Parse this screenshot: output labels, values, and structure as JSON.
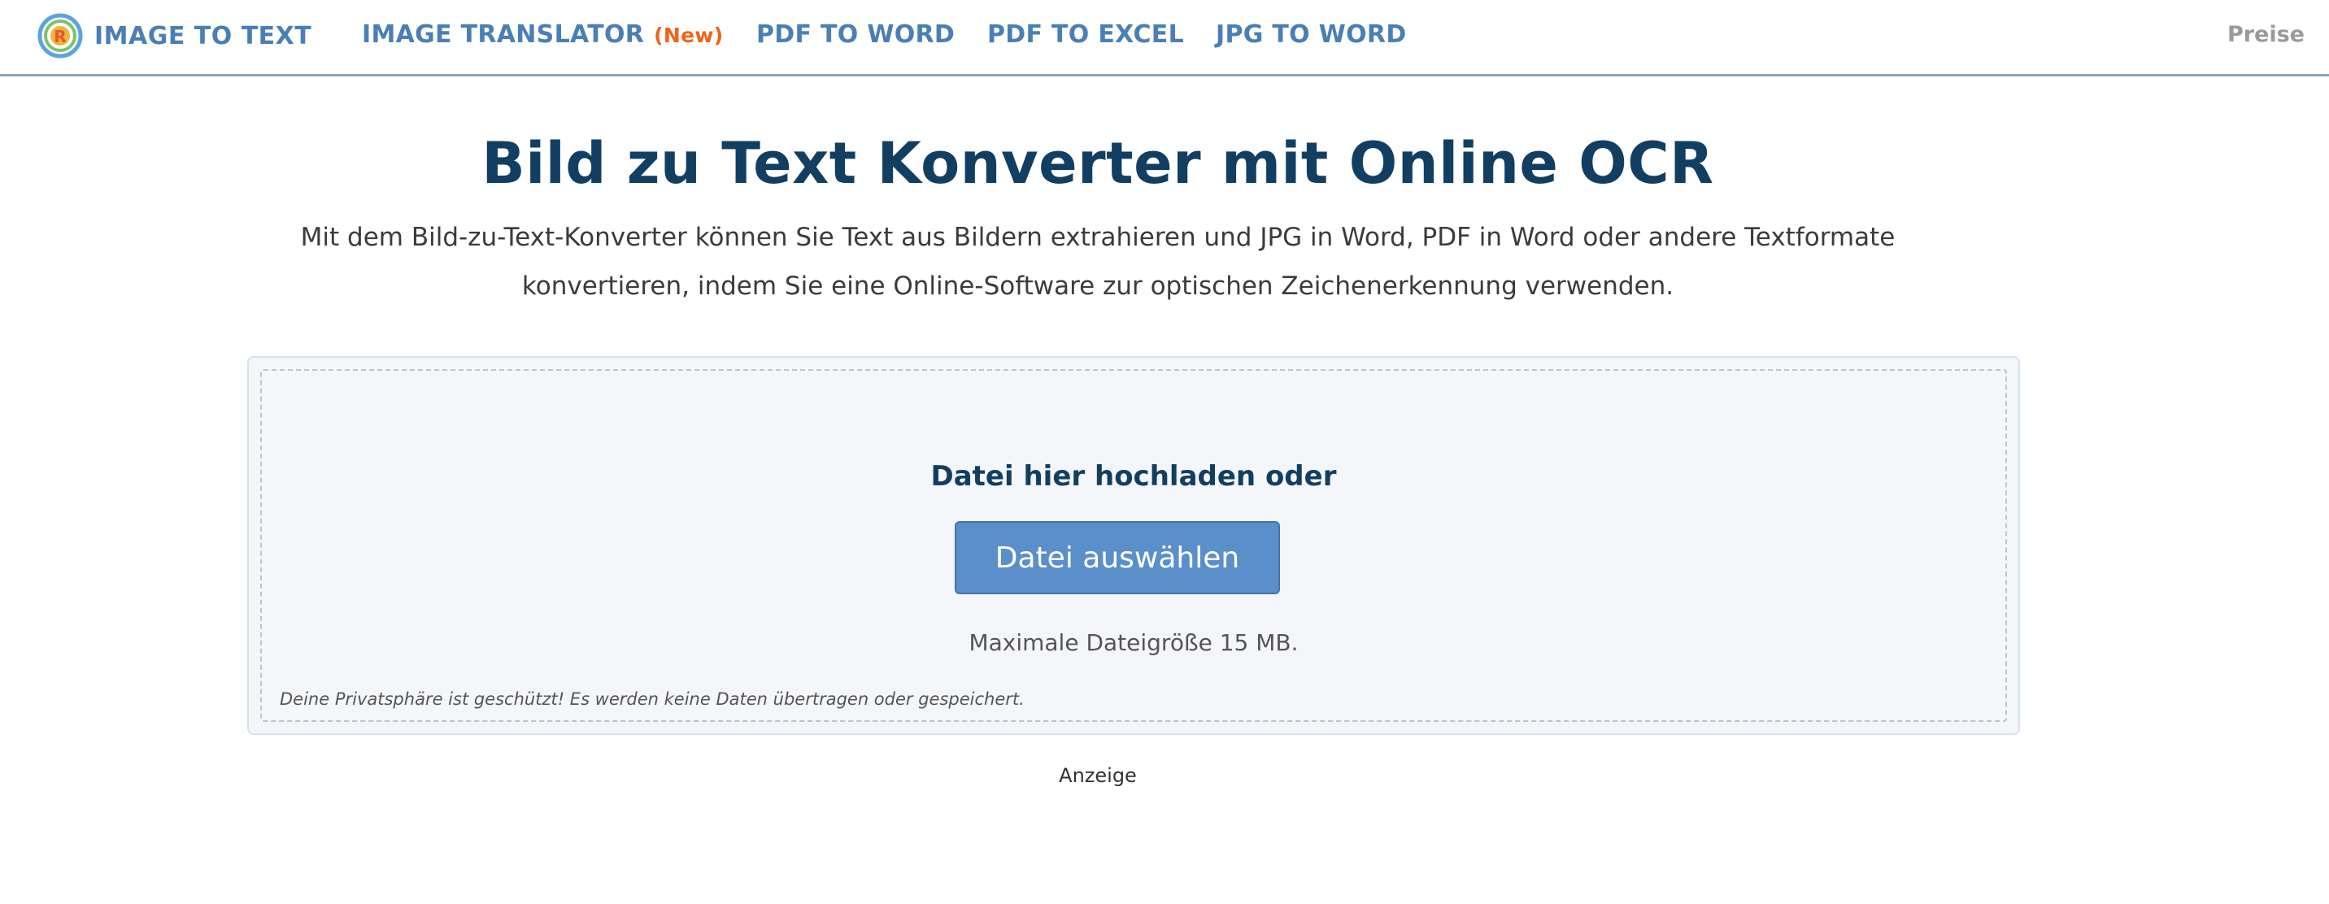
{
  "header": {
    "brand": "IMAGE TO TEXT",
    "nav": [
      {
        "label": "IMAGE TRANSLATOR",
        "badge": "(New)"
      },
      {
        "label": "PDF TO WORD"
      },
      {
        "label": "PDF TO EXCEL"
      },
      {
        "label": "JPG TO WORD"
      }
    ],
    "pricing_label": "Preise"
  },
  "main": {
    "title": "Bild zu Text Konverter mit Online OCR",
    "description": "Mit dem Bild-zu-Text-Konverter können Sie Text aus Bildern extrahieren und JPG in Word, PDF in Word oder andere Textformate konvertieren, indem Sie eine Online-Software zur optischen Zeichenerkennung verwenden."
  },
  "upload": {
    "heading": "Datei hier hochladen oder",
    "button_label": "Datei auswählen",
    "max_size": "Maximale Dateigröße 15 MB.",
    "privacy": "Deine Privatsphäre ist geschützt! Es werden keine Daten übertragen oder gespeichert."
  },
  "ad_label": "Anzeige",
  "colors": {
    "brand_blue": "#4a7fb5",
    "title_navy": "#123f61",
    "new_badge_orange": "#f06418",
    "button_blue": "#5b8fc9"
  },
  "icons": {
    "logo": "circular-r-logo-icon"
  }
}
